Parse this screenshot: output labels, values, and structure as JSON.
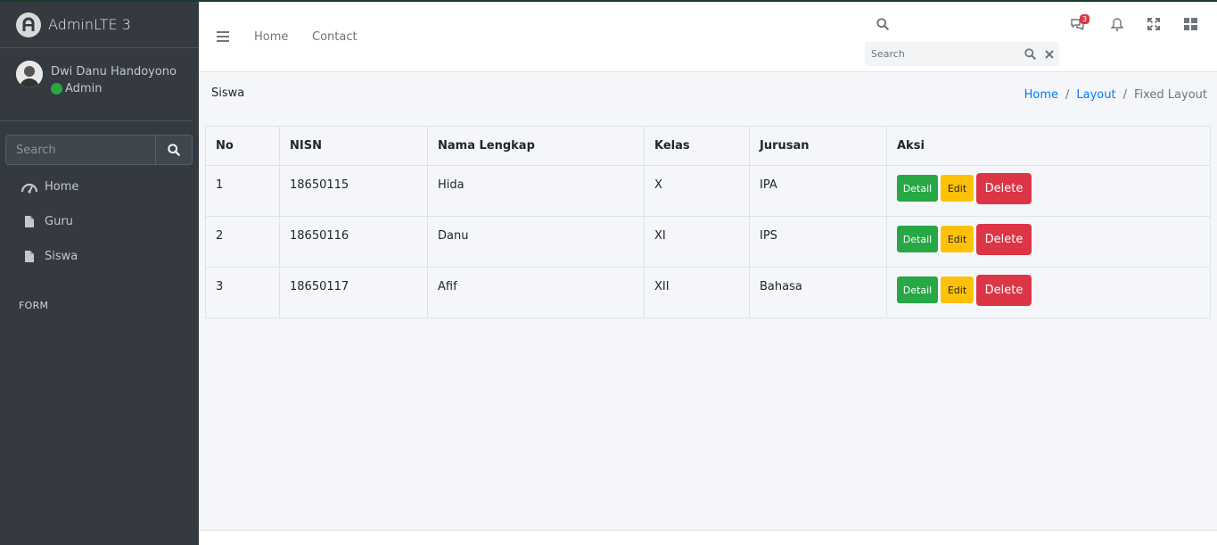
{
  "colors": {
    "sidebar_bg": "#343a40",
    "accent": "#007bff",
    "success": "#28a745",
    "warning": "#ffc107",
    "danger": "#dc3545"
  },
  "brand": {
    "name": "AdminLTE 3",
    "icon": "adminlte-logo-icon"
  },
  "user": {
    "name": "Dwi Danu Handoyono",
    "role": "Admin",
    "status_color": "#28a745"
  },
  "sidebar": {
    "search_placeholder": "Search",
    "items": [
      {
        "label": "Home",
        "icon": "dashboard-gauge-icon"
      },
      {
        "label": "Guru",
        "icon": "file-icon"
      },
      {
        "label": "Siswa",
        "icon": "file-icon"
      }
    ],
    "header": "FORM"
  },
  "topbar": {
    "links": [
      "Home",
      "Contact"
    ],
    "search_placeholder": "Search",
    "messages_badge": "3"
  },
  "page": {
    "title": "Siswa",
    "breadcrumb": [
      "Home",
      "Layout",
      "Fixed Layout"
    ]
  },
  "table": {
    "headers": [
      "No",
      "NISN",
      "Nama Lengkap",
      "Kelas",
      "Jurusan",
      "Aksi"
    ],
    "rows": [
      {
        "no": "1",
        "nisn": "18650115",
        "nama": "Hida",
        "kelas": "X",
        "jurusan": "IPA"
      },
      {
        "no": "2",
        "nisn": "18650116",
        "nama": "Danu",
        "kelas": "XI",
        "jurusan": "IPS"
      },
      {
        "no": "3",
        "nisn": "18650117",
        "nama": "Afif",
        "kelas": "XII",
        "jurusan": "Bahasa"
      }
    ],
    "actions": {
      "detail": "Detail",
      "edit": "Edit",
      "delete": "Delete"
    }
  }
}
